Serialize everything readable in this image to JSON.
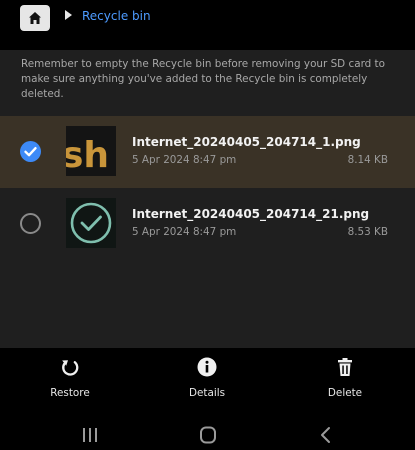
{
  "header": {
    "breadcrumb_label": "Recycle bin",
    "icons": [
      "home-icon",
      "chevron-right-icon"
    ]
  },
  "notice": "Remember to empty the Recycle bin before removing your SD card to make sure anything you've added to the Recycle bin is completely deleted.",
  "files": [
    {
      "name": "Internet_20240405_204714_1.png",
      "date": "5 Apr 2024 8:47 pm",
      "size": "8.14 KB",
      "selected": true,
      "thumbnail_text": "sh"
    },
    {
      "name": "Internet_20240405_204714_21.png",
      "date": "5 Apr 2024 8:47 pm",
      "size": "8.53 KB",
      "selected": false
    }
  ],
  "actions": {
    "restore": "Restore",
    "details": "Details",
    "delete": "Delete"
  },
  "colors": {
    "accent": "#3d8af7",
    "breadcrumb": "#4d9bff",
    "selected_row": "#3a3226",
    "panel": "#1f1f1f"
  }
}
